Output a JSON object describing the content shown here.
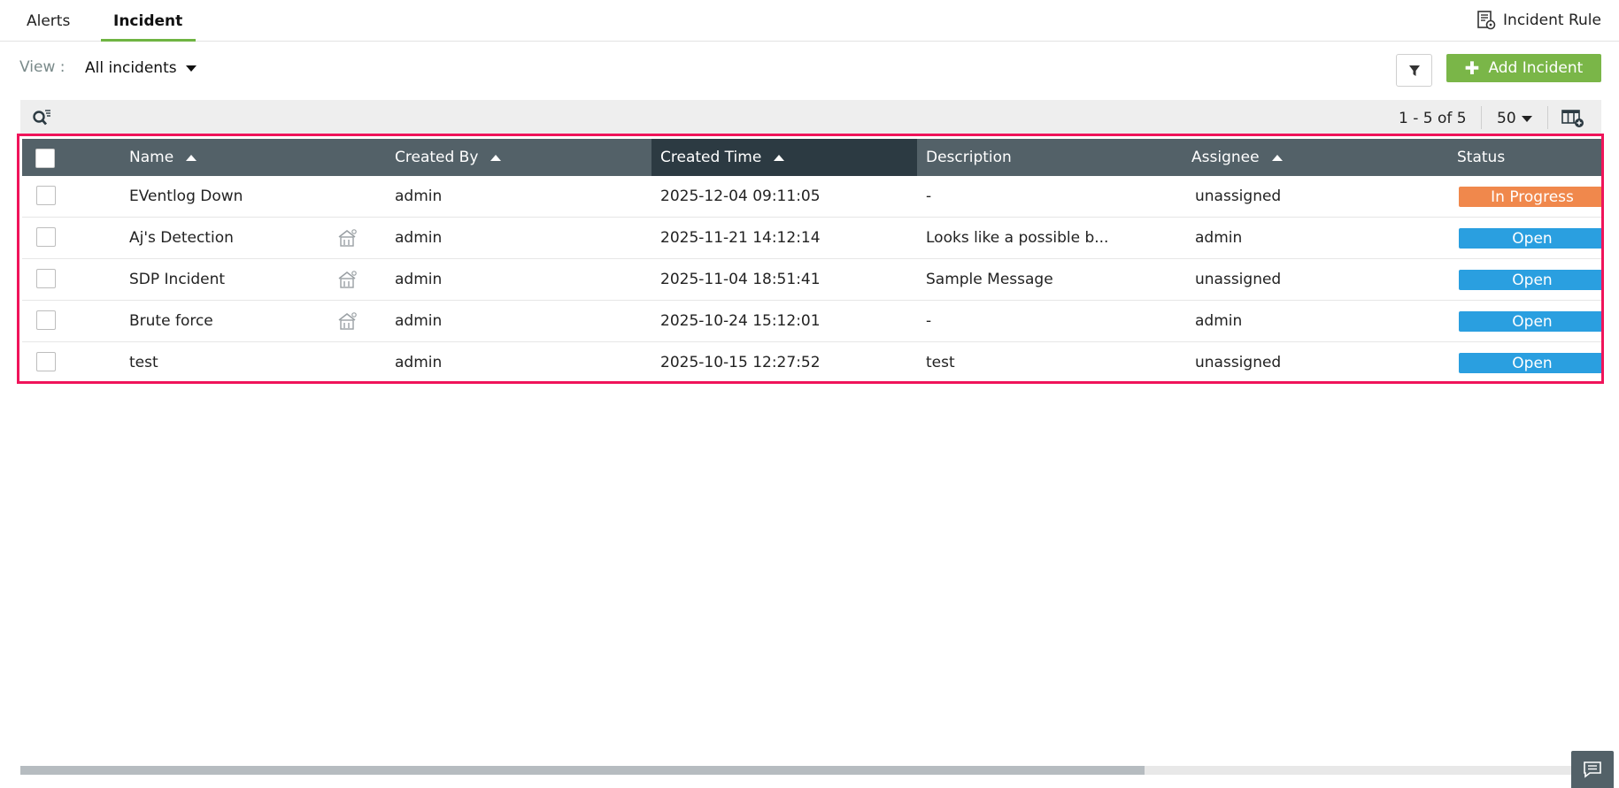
{
  "tabs": [
    {
      "label": "Alerts",
      "active": false
    },
    {
      "label": "Incident",
      "active": true
    }
  ],
  "incident_rule": {
    "label": "Incident Rule",
    "icon": "incident-rule-icon"
  },
  "view": {
    "label": "View :",
    "selected": "All incidents"
  },
  "actions": {
    "add_incident_label": "Add Incident",
    "filter_icon": "filter-icon"
  },
  "toolbar": {
    "pager": "1 - 5 of 5",
    "page_size": "50"
  },
  "table": {
    "columns": [
      {
        "label": "Name",
        "sortable": true
      },
      {
        "label": "Created By",
        "sortable": true
      },
      {
        "label": "Created Time",
        "sortable": true,
        "sorted": true
      },
      {
        "label": "Description",
        "sortable": false
      },
      {
        "label": "Assignee",
        "sortable": true
      },
      {
        "label": "Status",
        "sortable": false
      }
    ],
    "rows": [
      {
        "name": "EVentlog Down",
        "linked": false,
        "created_by": "admin",
        "created_time": "2025-12-04 09:11:05",
        "description": "-",
        "assignee": "unassigned",
        "status": "In Progress",
        "status_color": "#f0884c"
      },
      {
        "name": "Aj's Detection",
        "linked": true,
        "created_by": "admin",
        "created_time": "2025-11-21 14:12:14",
        "description": "Looks like a possible b...",
        "assignee": "admin",
        "status": "Open",
        "status_color": "#2a9fe0"
      },
      {
        "name": "SDP Incident",
        "linked": true,
        "created_by": "admin",
        "created_time": "2025-11-04 18:51:41",
        "description": "Sample Message",
        "assignee": "unassigned",
        "status": "Open",
        "status_color": "#2a9fe0"
      },
      {
        "name": "Brute force",
        "linked": true,
        "created_by": "admin",
        "created_time": "2025-10-24 15:12:01",
        "description": "-",
        "assignee": "admin",
        "status": "Open",
        "status_color": "#2a9fe0"
      },
      {
        "name": "test",
        "linked": false,
        "created_by": "admin",
        "created_time": "2025-10-15 12:27:52",
        "description": "test",
        "assignee": "unassigned",
        "status": "Open",
        "status_color": "#2a9fe0"
      }
    ]
  },
  "colors": {
    "accent_green": "#7ab648",
    "header_bg": "#536168",
    "sorted_header_bg": "#2c3a42",
    "highlight_border": "#f0145a"
  }
}
